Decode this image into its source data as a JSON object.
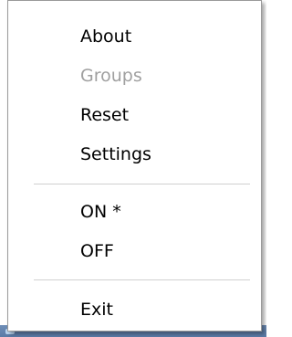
{
  "menu": {
    "items": [
      {
        "label": "About",
        "enabled": true
      },
      {
        "label": "Groups",
        "enabled": false
      },
      {
        "label": "Reset",
        "enabled": true
      },
      {
        "label": "Settings",
        "enabled": true
      },
      {
        "label": "ON *",
        "enabled": true
      },
      {
        "label": "OFF",
        "enabled": true
      },
      {
        "label": "Exit",
        "enabled": true
      }
    ]
  },
  "colors": {
    "enabled_text": "#000000",
    "disabled_text": "#a0a0a0",
    "separator": "#d0d0d0",
    "border": "#9a9a9a"
  }
}
